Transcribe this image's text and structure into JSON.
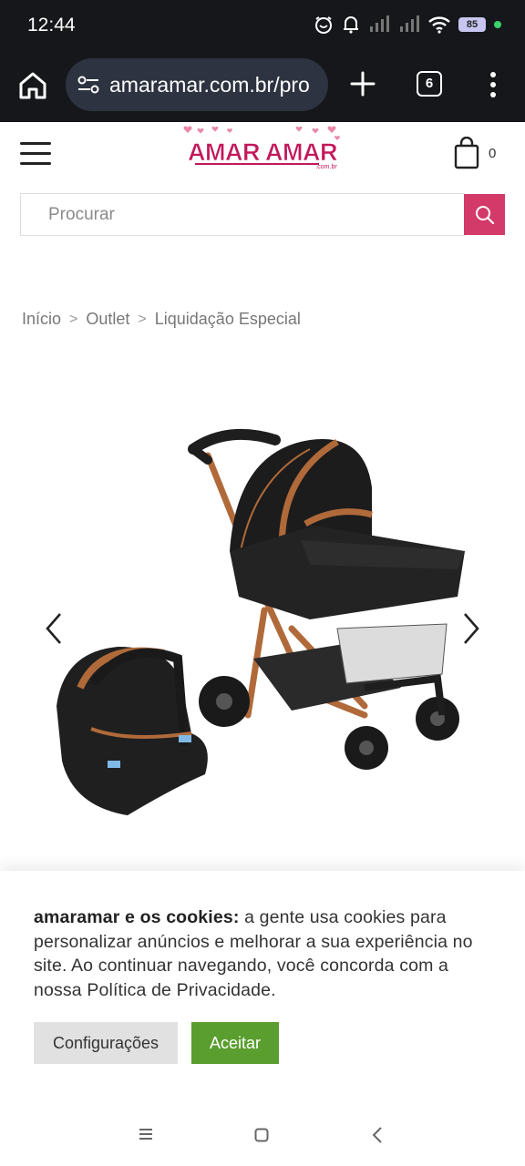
{
  "status_bar": {
    "time": "12:44",
    "battery_level": "85",
    "icons": [
      "alarm-icon",
      "bell-icon",
      "signal-icon",
      "signal-icon",
      "wifi-icon",
      "battery-icon"
    ]
  },
  "browser": {
    "url": "amaramar.com.br/pro",
    "tab_count": "6"
  },
  "header": {
    "logo_text": "AMAR AMAR",
    "logo_suffix": ".com.br",
    "cart_count": "0",
    "brand_color": "#c2185b"
  },
  "search": {
    "placeholder": "Procurar",
    "button_color": "#d33a6a"
  },
  "breadcrumb": {
    "items": [
      "Início",
      "Outlet",
      "Liquidação Especial"
    ]
  },
  "cookie_banner": {
    "title": "amaramar e os cookies:",
    "body": " a gente usa cookies para personalizar anúncios e melhorar a sua experiência no site. Ao continuar navegando, você concorda com a nossa Política de Privacidade.",
    "config_label": "Configurações",
    "accept_label": "Aceitar",
    "accept_color": "#5a9e2f"
  }
}
